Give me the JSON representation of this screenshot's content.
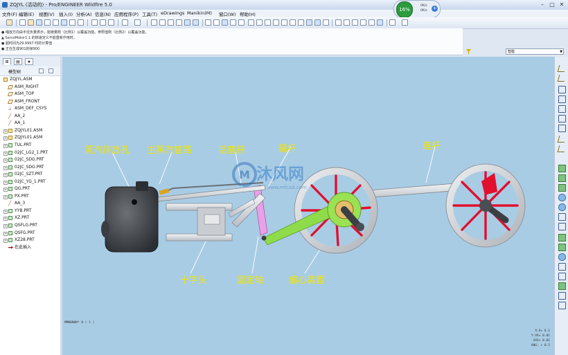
{
  "window": {
    "title": "ZQJYL (活动的) - Pro/ENGINEER Wildfire 5.0",
    "controls": [
      "minimize",
      "maximize",
      "close"
    ]
  },
  "menu": [
    "文件(F)",
    "编辑(E)",
    "视图(V)",
    "插入(I)",
    "分析(A)",
    "信息(N)",
    "应用程序(P)",
    "工具(T)",
    "eDrawings",
    "Manikin(M)",
    "窗口(W)",
    "帮助(H)"
  ],
  "messages": [
    "● 缩放方向由半径负量表示，能链量刚（比例1）以覆盖功能。参照值刚（比例2）以覆盖功能。",
    "▲ ServoMotor1.1 的转速定义不能重新作用时。",
    "● 超时间为29.9997 时的计算值",
    "● 正在生成901的帧900"
  ],
  "dashboard": {
    "percent": "16%",
    "row1": "0K/s",
    "row2": "0K/s",
    "plus": "+"
  },
  "filter": {
    "selected": "智能"
  },
  "model_tree": {
    "tab_label": "模型树",
    "items": [
      {
        "label": "ZQJYL.ASM",
        "icon": "asm",
        "level": 0,
        "expandable": false
      },
      {
        "label": "ASM_RIGHT",
        "icon": "plane",
        "level": 1,
        "expandable": false
      },
      {
        "label": "ASM_TOP",
        "icon": "plane",
        "level": 1,
        "expandable": false
      },
      {
        "label": "ASM_FRONT",
        "icon": "plane",
        "level": 1,
        "expandable": false
      },
      {
        "label": "ASM_DEF_CSYS",
        "icon": "csys",
        "level": 1,
        "expandable": false
      },
      {
        "label": "AA_2",
        "icon": "axis",
        "level": 1,
        "expandable": false
      },
      {
        "label": "AA_1",
        "icon": "axis",
        "level": 1,
        "expandable": false
      },
      {
        "label": "ZQJYL01.ASM",
        "icon": "asm",
        "level": 1,
        "expandable": true
      },
      {
        "label": "ZQJYL01.ASM",
        "icon": "asm",
        "level": 1,
        "expandable": true
      },
      {
        "label": "TUL.PRT",
        "icon": "part",
        "level": 1,
        "expandable": true
      },
      {
        "label": "02JC_LG2_1.PRT",
        "icon": "part",
        "level": 1,
        "expandable": true
      },
      {
        "label": "02JC_SDG.PRT",
        "icon": "part",
        "level": 1,
        "expandable": true
      },
      {
        "label": "02JC_SDG.PRT",
        "icon": "part",
        "level": 1,
        "expandable": true
      },
      {
        "label": "02JC_SZT.PRT",
        "icon": "part",
        "level": 1,
        "expandable": true
      },
      {
        "label": "02JC_YG_1.PRT",
        "icon": "part",
        "level": 1,
        "expandable": true
      },
      {
        "label": "QG.PRT",
        "icon": "part",
        "level": 1,
        "expandable": true
      },
      {
        "label": "PX.PRT",
        "icon": "part",
        "level": 1,
        "expandable": true
      },
      {
        "label": "AA_3",
        "icon": "axis",
        "level": 1,
        "expandable": false
      },
      {
        "label": "YYB.PRT",
        "icon": "part",
        "level": 1,
        "expandable": true
      },
      {
        "label": "XZ.PRT",
        "icon": "part",
        "level": 1,
        "expandable": true
      },
      {
        "label": "QSFLG.PRT",
        "icon": "part",
        "level": 1,
        "expandable": true
      },
      {
        "label": "QSFG.PRT",
        "icon": "part",
        "level": 1,
        "expandable": true
      },
      {
        "label": "XZ28.PRT",
        "icon": "part",
        "level": 1,
        "expandable": true
      },
      {
        "label": "在此插入",
        "icon": "insert",
        "level": 1,
        "expandable": false
      }
    ]
  },
  "callouts": [
    {
      "id": "exhaust",
      "text": "蒸汽排放孔"
    },
    {
      "id": "steam-pipe",
      "text": "主蒸汽管路"
    },
    {
      "id": "piston-rod",
      "text": "活塞杆"
    },
    {
      "id": "rocker",
      "text": "摇杆"
    },
    {
      "id": "connecting-rod",
      "text": "连杆"
    },
    {
      "id": "crosshead",
      "text": "十字头"
    },
    {
      "id": "fixed-shaft",
      "text": "固定轴"
    },
    {
      "id": "eccentric",
      "text": "偏心装置"
    }
  ],
  "watermark": {
    "main": "沐风网",
    "sub": "www.mfcad.com"
  },
  "viewport_status": "MMN0N0N* 0 ( 1 )",
  "coords": [
    "X:X+ 0.1",
    "Y:XX+ 0.01",
    "XXX+ 0.01",
    "ANG: + 0.5"
  ],
  "colors": {
    "viewport_bg": "#a9cce5",
    "callout_text": "#f0e500",
    "wheel_spokes": "#e0102e",
    "eccentric_green": "#8fdc4a",
    "rocker_pink": "#e8a0e6"
  }
}
